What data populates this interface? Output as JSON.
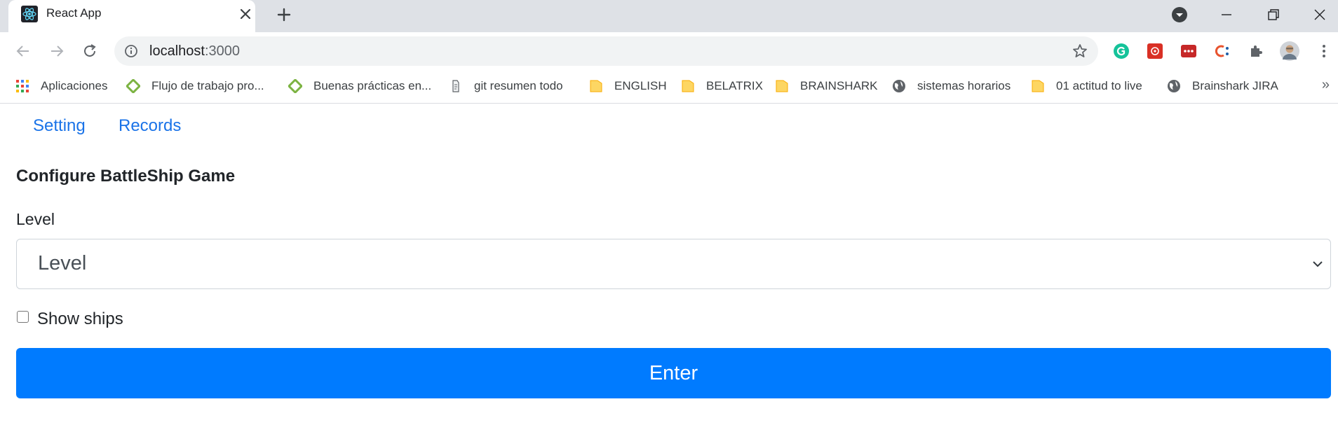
{
  "browser": {
    "tab": {
      "title": "React App",
      "favicon": "react-icon"
    },
    "address": {
      "host": "localhost",
      "port": ":3000"
    },
    "icons": {
      "minimize": "minimize-icon",
      "maximize": "restore-icon",
      "close": "close-icon",
      "profile_dropdown": "chevron-down-icon",
      "back": "back-arrow-icon",
      "forward": "forward-arrow-icon",
      "reload": "reload-icon",
      "info": "info-icon",
      "bookmark_star": "star-icon",
      "extensions": [
        "grammarly-icon",
        "extension-icon",
        "lastpass-icon",
        "clockify-icon",
        "puzzle-icon",
        "avatar",
        "more-menu-icon"
      ]
    },
    "bookmarks": [
      {
        "label": "Aplicaciones",
        "icon": "apps-grid-icon"
      },
      {
        "label": "Flujo de trabajo pro...",
        "icon": "diamond-icon"
      },
      {
        "label": "Buenas prácticas en...",
        "icon": "diamond-icon"
      },
      {
        "label": "git resumen todo",
        "icon": "page-icon"
      },
      {
        "label": "ENGLISH",
        "icon": "folder-icon"
      },
      {
        "label": "BELATRIX",
        "icon": "folder-icon"
      },
      {
        "label": "BRAINSHARK",
        "icon": "folder-icon"
      },
      {
        "label": "sistemas horarios",
        "icon": "globe-icon"
      },
      {
        "label": "01 actitud to live",
        "icon": "folder-icon"
      },
      {
        "label": "Brainshark JIRA",
        "icon": "globe-icon"
      }
    ],
    "bookmarks_more": "»"
  },
  "app": {
    "nav": [
      {
        "label": "Setting"
      },
      {
        "label": "Records"
      }
    ],
    "form": {
      "heading": "Configure BattleShip Game",
      "level_label": "Level",
      "level_select_value": "Level",
      "show_ships_label": "Show ships",
      "show_ships_checked": false,
      "submit_label": "Enter"
    },
    "colors": {
      "link": "#1a73e8",
      "primary_button": "#007bff",
      "text": "#212529"
    }
  }
}
